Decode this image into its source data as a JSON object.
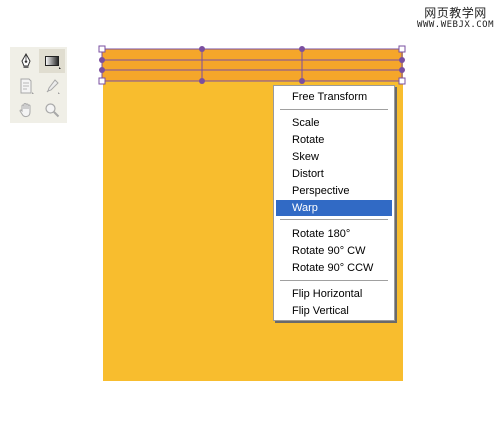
{
  "watermark": {
    "title": "网页教学网",
    "url": "WWW.WEBJX.COM"
  },
  "tools": [
    {
      "icon": "pen-icon",
      "selected": false
    },
    {
      "icon": "gradient-icon",
      "selected": true
    },
    {
      "icon": "notes-icon",
      "selected": false
    },
    {
      "icon": "eyedropper-icon",
      "selected": false
    },
    {
      "icon": "hand-icon",
      "selected": false
    },
    {
      "icon": "zoom-icon",
      "selected": false
    }
  ],
  "colors": {
    "canvas": "#f8bd2e",
    "layer_fill": "#f5a62a",
    "transform_stroke": "#7a4fa0",
    "menu_highlight": "#316ac5"
  },
  "context_menu": {
    "groups": [
      [
        "Free Transform"
      ],
      [
        "Scale",
        "Rotate",
        "Skew",
        "Distort",
        "Perspective",
        "Warp"
      ],
      [
        "Rotate 180°",
        "Rotate 90° CW",
        "Rotate 90° CCW"
      ],
      [
        "Flip Horizontal",
        "Flip Vertical"
      ]
    ],
    "highlighted": "Warp"
  }
}
